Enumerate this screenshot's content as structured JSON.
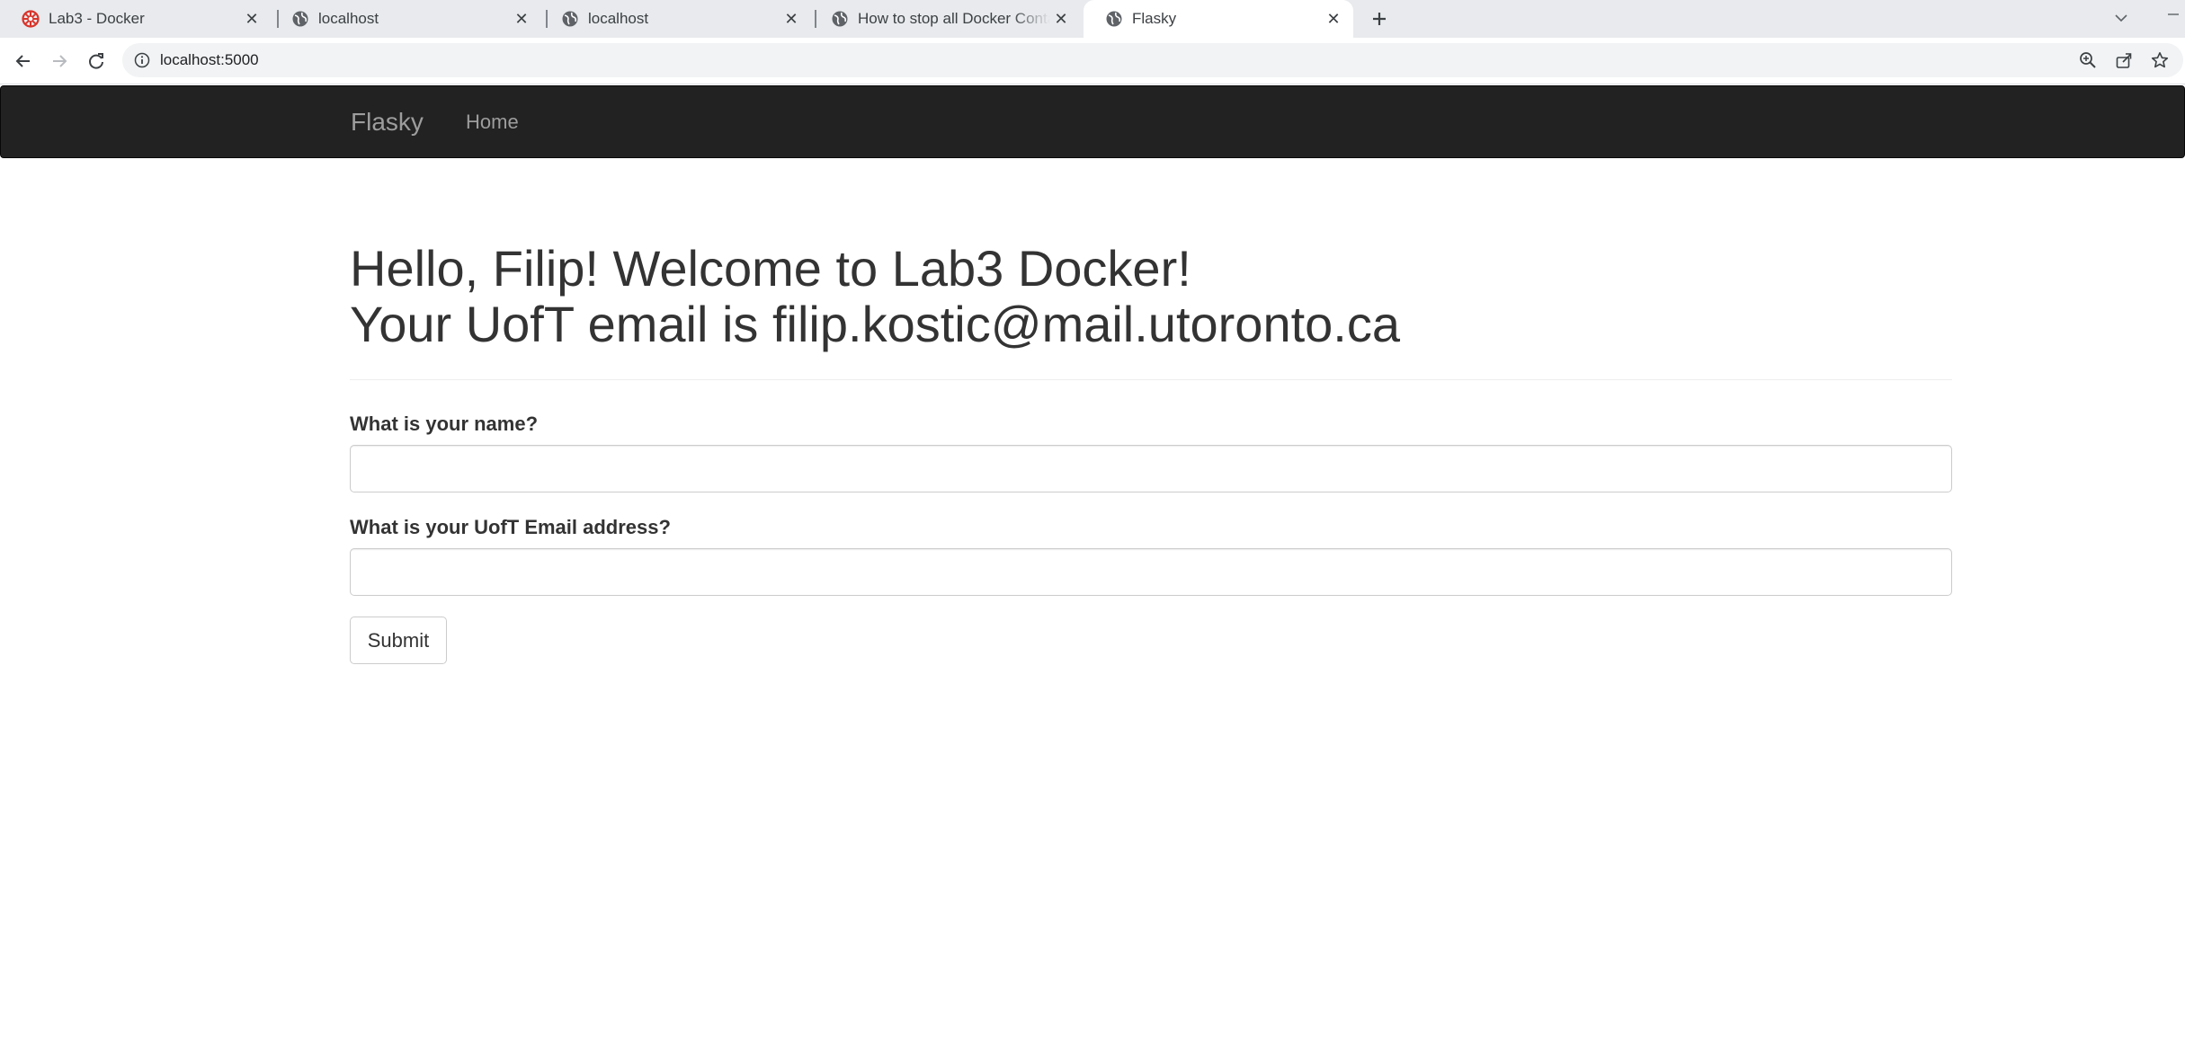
{
  "browser": {
    "tabs": [
      {
        "title": "Lab3 - Docker",
        "icon": "red-logo-icon",
        "active": false
      },
      {
        "title": "localhost",
        "icon": "globe-icon",
        "active": false
      },
      {
        "title": "localhost",
        "icon": "globe-icon",
        "active": false
      },
      {
        "title": "How to stop all Docker Containers",
        "icon": "globe-icon",
        "active": false
      },
      {
        "title": "Flasky",
        "icon": "globe-icon",
        "active": true
      }
    ],
    "url": "localhost:5000"
  },
  "navbar": {
    "brand": "Flasky",
    "links": [
      "Home"
    ],
    "background": "#222222"
  },
  "main": {
    "greeting_line1": "Hello, Filip! Welcome to Lab3 Docker!",
    "greeting_line2": "Your UofT email is filip.kostic@mail.utoronto.ca",
    "form": {
      "name_label": "What is your name?",
      "name_value": "",
      "email_label": "What is your UofT Email address?",
      "email_value": "",
      "submit_label": "Submit"
    }
  }
}
